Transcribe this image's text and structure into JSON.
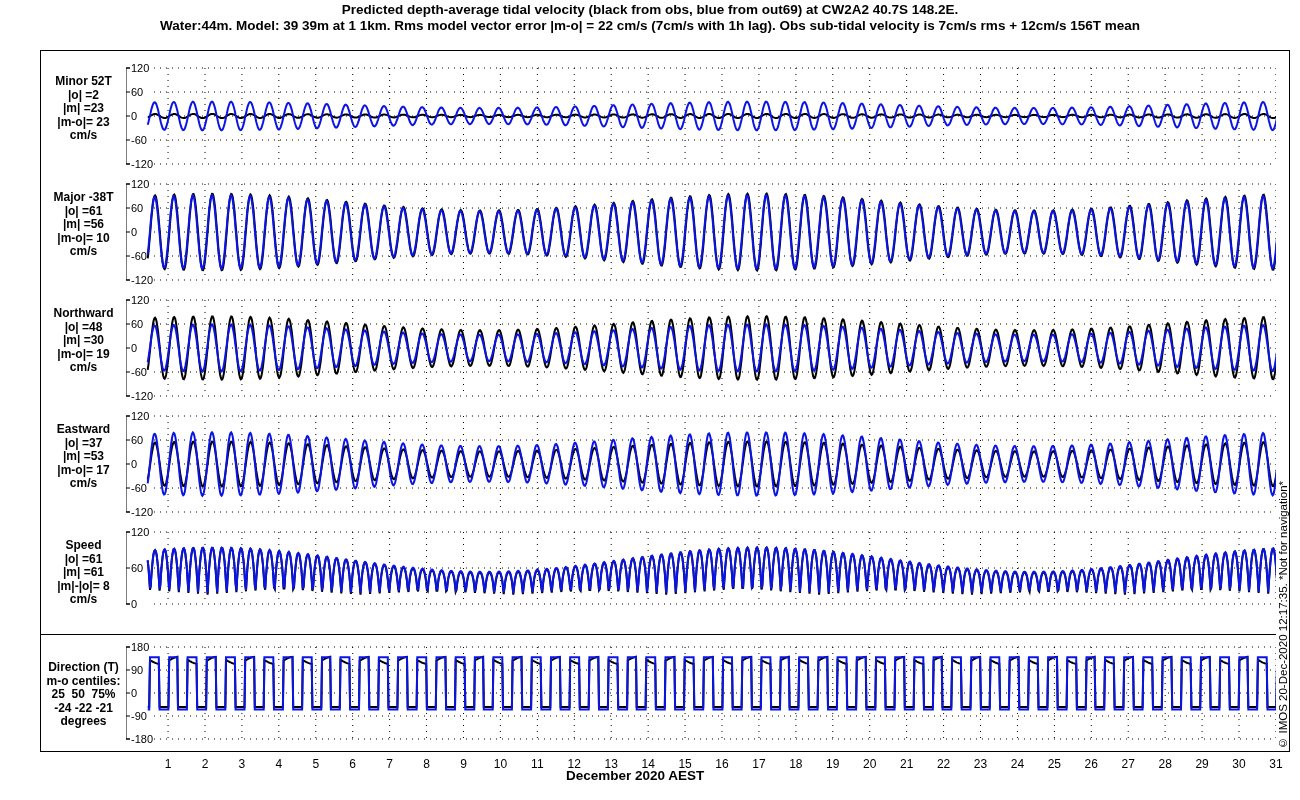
{
  "title": [
    "Predicted depth-average tidal velocity (black from obs, blue from out69) at CW2A2 40.7S 148.2E.",
    "Water:44m. Model: 39 39m at 1 1km. Rms model vector error |m-o| = 22 cm/s (7cm/s with 1h lag). Obs sub-tidal velocity is 7cm/s rms + 12cm/s 156T mean"
  ],
  "panels": [
    {
      "kind": "velocity",
      "label": [
        "Minor 52T",
        "|o| =2",
        "|m| =23",
        "|m-o|= 23",
        "cm/s"
      ],
      "yticks": [
        "120",
        "60",
        "0",
        "-60",
        "-120"
      ]
    },
    {
      "kind": "velocity",
      "label": [
        "Major -38T",
        "|o| =61",
        "|m| =56",
        "|m-o|= 10",
        "cm/s"
      ],
      "yticks": [
        "120",
        "60",
        "0",
        "-60",
        "-120"
      ]
    },
    {
      "kind": "velocity",
      "label": [
        "Northward",
        "|o| =48",
        "|m| =30",
        "|m-o|= 19",
        "cm/s"
      ],
      "yticks": [
        "120",
        "60",
        "0",
        "-60",
        "-120"
      ]
    },
    {
      "kind": "velocity",
      "label": [
        "Eastward",
        "|o| =37",
        "|m| =53",
        "|m-o|= 17",
        "cm/s"
      ],
      "yticks": [
        "120",
        "60",
        "0",
        "-60",
        "-120"
      ]
    },
    {
      "kind": "speed",
      "label": [
        "Speed",
        "|o| =61",
        "|m| =61",
        "|m|-|o|= 8",
        "cm/s"
      ],
      "yticks": [
        "120",
        "60",
        "0"
      ]
    },
    {
      "kind": "direction",
      "label": [
        "Direction (T)",
        "m-o centiles:",
        "25  50  75%",
        "-24 -22 -21",
        "degrees"
      ],
      "yticks": [
        "180",
        "90",
        "0",
        "-90",
        "-180"
      ]
    }
  ],
  "days": [
    "1",
    "2",
    "3",
    "4",
    "5",
    "6",
    "7",
    "8",
    "9",
    "10",
    "11",
    "12",
    "13",
    "14",
    "15",
    "16",
    "17",
    "18",
    "19",
    "20",
    "21",
    "22",
    "23",
    "24",
    "25",
    "26",
    "27",
    "28",
    "29",
    "30",
    "31"
  ],
  "xlabel": "December 2020 AEST",
  "credit": "© IMOS 20-Dec-2020 12:17:35. *Not for navigation*"
}
